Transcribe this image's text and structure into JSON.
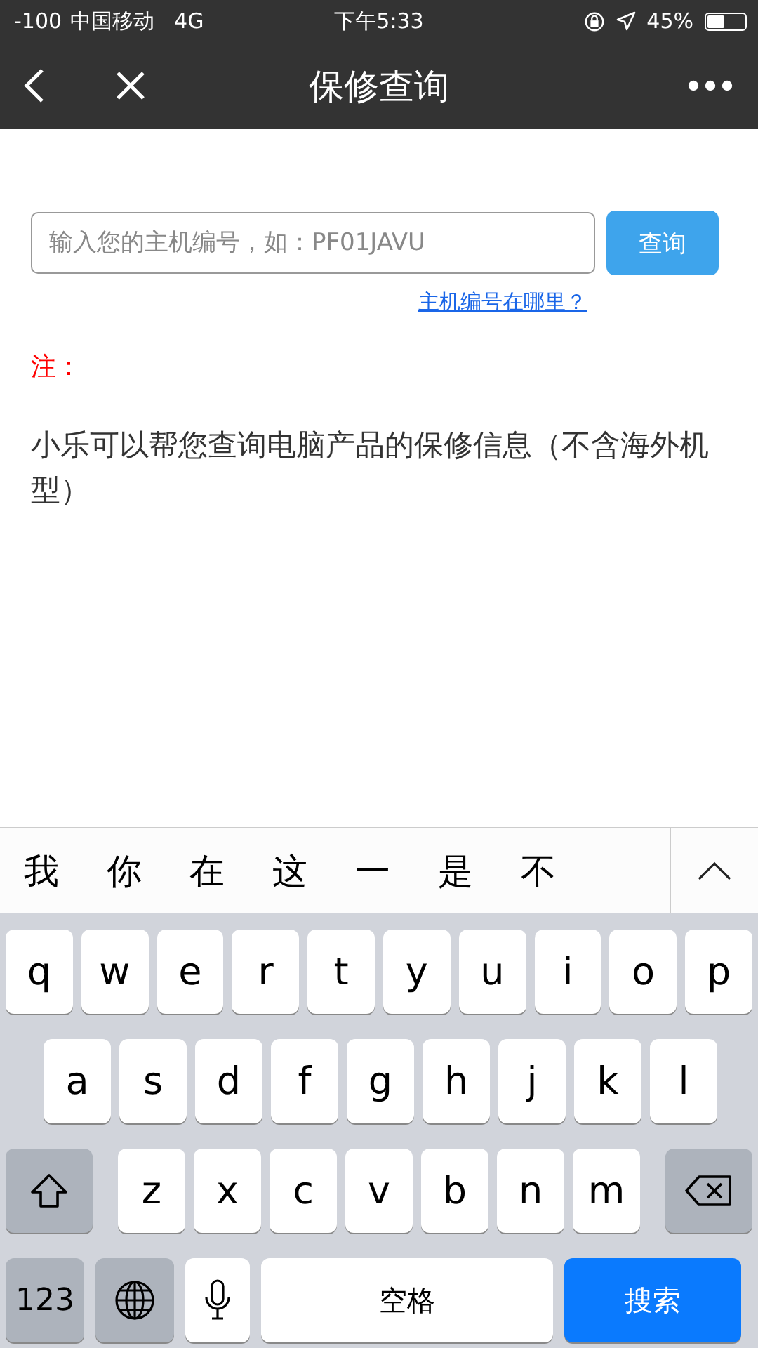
{
  "status_bar": {
    "signal": "-100",
    "carrier": "中国移动",
    "network": "4G",
    "time": "下午5:33",
    "battery": "45%",
    "level": 0.45
  },
  "nav": {
    "title": "保修查询"
  },
  "search": {
    "placeholder": "输入您的主机编号，如：PF01JAVU",
    "button": "查询",
    "help_link": "主机编号在哪里？"
  },
  "note": {
    "label": "注：",
    "text": "小乐可以帮您查询电脑产品的保修信息（不含海外机型）"
  },
  "candidates": [
    "我",
    "你",
    "在",
    "这",
    "一",
    "是",
    "不"
  ],
  "keyboard": {
    "rows": [
      [
        "q",
        "w",
        "e",
        "r",
        "t",
        "y",
        "u",
        "i",
        "o",
        "p"
      ],
      [
        "a",
        "s",
        "d",
        "f",
        "g",
        "h",
        "j",
        "k",
        "l"
      ],
      [
        "z",
        "x",
        "c",
        "v",
        "b",
        "n",
        "m"
      ]
    ],
    "numbers_key": "123",
    "space_key": "空格",
    "search_key": "搜索"
  }
}
